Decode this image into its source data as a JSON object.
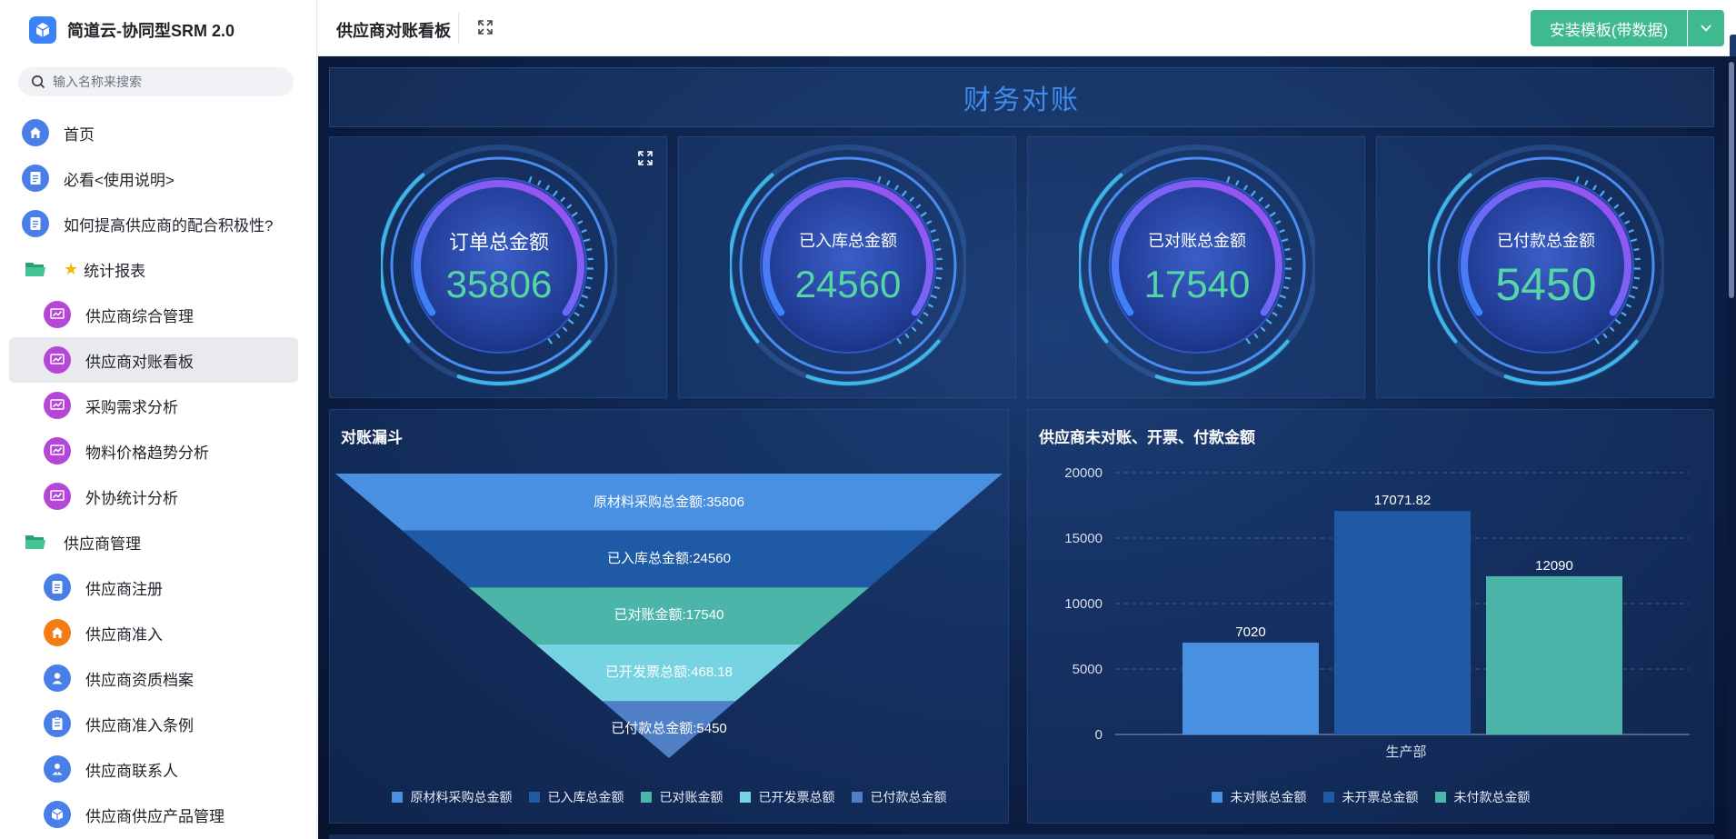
{
  "app": {
    "title": "简道云-协同型SRM 2.0"
  },
  "search": {
    "placeholder": "输入名称来搜索"
  },
  "sidebar": {
    "items": [
      {
        "label": "首页"
      },
      {
        "label": "必看<使用说明>"
      },
      {
        "label": "如何提高供应商的配合积极性?"
      },
      {
        "label": "统计报表"
      },
      {
        "label": "供应商综合管理"
      },
      {
        "label": "供应商对账看板"
      },
      {
        "label": "采购需求分析"
      },
      {
        "label": "物料价格趋势分析"
      },
      {
        "label": "外协统计分析"
      },
      {
        "label": "供应商管理"
      },
      {
        "label": "供应商注册"
      },
      {
        "label": "供应商准入"
      },
      {
        "label": "供应商资质档案"
      },
      {
        "label": "供应商准入条例"
      },
      {
        "label": "供应商联系人"
      },
      {
        "label": "供应商供应产品管理"
      }
    ]
  },
  "topbar": {
    "page_title": "供应商对账看板",
    "install_label": "安装模板(带数据)"
  },
  "dashboard": {
    "header_title": "财务对账",
    "kpis": [
      {
        "label": "订单总金额",
        "value": "35806"
      },
      {
        "label": "已入库总金额",
        "value": "24560"
      },
      {
        "label": "已对账总金额",
        "value": "17540"
      },
      {
        "label": "已付款总金额",
        "value": "5450"
      }
    ],
    "funnel": {
      "title": "对账漏斗",
      "stages": [
        {
          "label": "原材料采购总金额:35806",
          "legend": "原材料采购总金额",
          "color": "#4a90e2"
        },
        {
          "label": "已入库总金额:24560",
          "legend": "已入库总金额",
          "color": "#1f5aa6"
        },
        {
          "label": "已对账金额:17540",
          "legend": "已对账金额",
          "color": "#4cb5a9"
        },
        {
          "label": "已开发票总额:468.18",
          "legend": "已开发票总额",
          "color": "#75d3e2"
        },
        {
          "label": "已付款总金额:5450",
          "legend": "已付款总金额",
          "color": "#4f7fc6"
        }
      ]
    }
  },
  "chart_data": {
    "type": "bar",
    "title": "供应商未对账、开票、付款金额",
    "categories": [
      "生产部"
    ],
    "series": [
      {
        "name": "未对账总金额",
        "values": [
          7020
        ],
        "color": "#4a90e2"
      },
      {
        "name": "未开票总金额",
        "values": [
          17071.82
        ],
        "color": "#1f5aa6"
      },
      {
        "name": "未付款总金额",
        "values": [
          12090
        ],
        "color": "#4cb5a9"
      }
    ],
    "yticks": [
      "0",
      "5000",
      "10000",
      "15000",
      "20000"
    ],
    "ylim": [
      0,
      20000
    ],
    "grid": true,
    "legend_position": "bottom"
  }
}
